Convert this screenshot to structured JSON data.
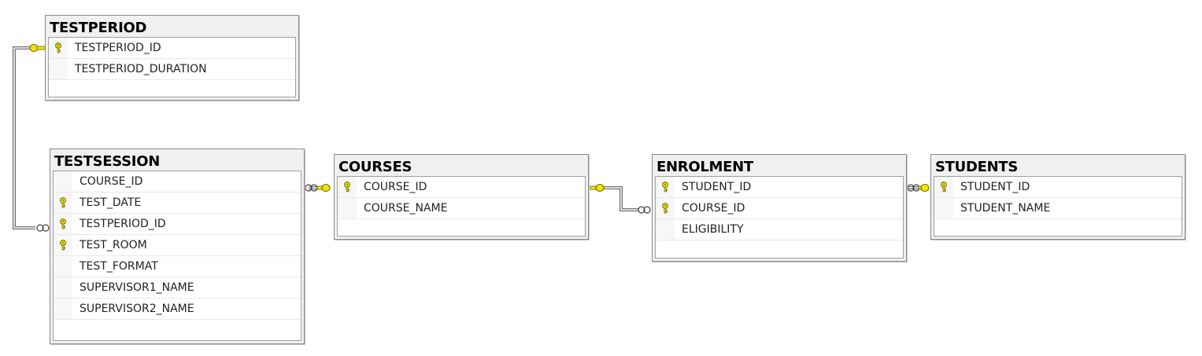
{
  "tables": [
    {
      "id": "testperiod",
      "title": "TESTPERIOD",
      "columns": [
        {
          "name": "TESTPERIOD_ID",
          "pk": true
        },
        {
          "name": "TESTPERIOD_DURATION",
          "pk": false
        }
      ]
    },
    {
      "id": "testsession",
      "title": "TESTSESSION",
      "columns": [
        {
          "name": "COURSE_ID",
          "pk": false
        },
        {
          "name": "TEST_DATE",
          "pk": true
        },
        {
          "name": "TESTPERIOD_ID",
          "pk": true
        },
        {
          "name": "TEST_ROOM",
          "pk": true
        },
        {
          "name": "TEST_FORMAT",
          "pk": false
        },
        {
          "name": "SUPERVISOR1_NAME",
          "pk": false
        },
        {
          "name": "SUPERVISOR2_NAME",
          "pk": false
        }
      ]
    },
    {
      "id": "courses",
      "title": "COURSES",
      "columns": [
        {
          "name": "COURSE_ID",
          "pk": true
        },
        {
          "name": "COURSE_NAME",
          "pk": false
        }
      ]
    },
    {
      "id": "enrolment",
      "title": "ENROLMENT",
      "columns": [
        {
          "name": "STUDENT_ID",
          "pk": true
        },
        {
          "name": "COURSE_ID",
          "pk": true
        },
        {
          "name": "ELIGIBILITY",
          "pk": false
        }
      ]
    },
    {
      "id": "students",
      "title": "STUDENTS",
      "columns": [
        {
          "name": "STUDENT_ID",
          "pk": true
        },
        {
          "name": "STUDENT_NAME",
          "pk": false
        }
      ]
    }
  ],
  "relationships": [
    {
      "one": "testperiod",
      "many": "testsession"
    },
    {
      "one": "courses",
      "many": "testsession"
    },
    {
      "one": "courses",
      "many": "enrolment"
    },
    {
      "one": "students",
      "many": "enrolment"
    }
  ],
  "colors": {
    "key": "#f2e600",
    "key_outline": "#6a6200",
    "line": "#6e6e6e"
  },
  "icons": {
    "primary_key": "key-icon",
    "one_end": "key-connector-icon",
    "many_end": "infinity-icon"
  }
}
